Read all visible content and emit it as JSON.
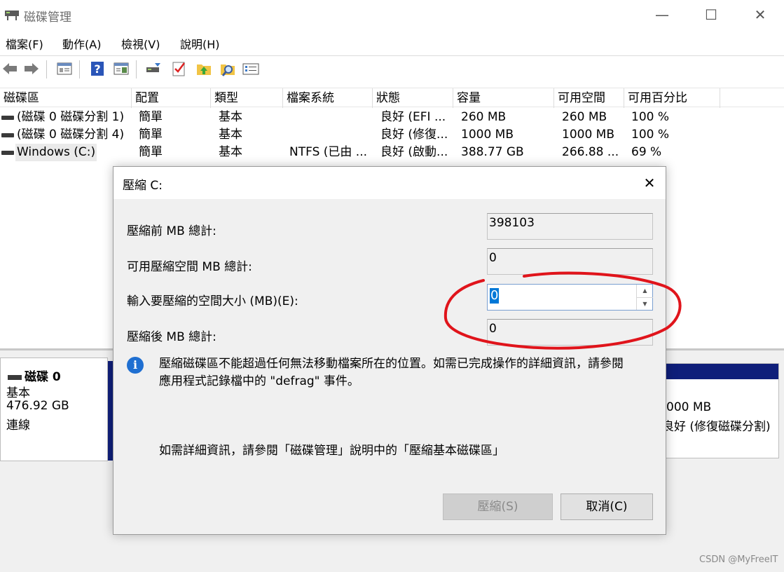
{
  "window": {
    "title": "磁碟管理",
    "controls": {
      "minimize": "—",
      "maximize": "☐",
      "close": "✕"
    }
  },
  "menu": [
    "檔案(F)",
    "動作(A)",
    "檢視(V)",
    "說明(H)"
  ],
  "toolbar": {
    "icons": [
      "back-arrow-icon",
      "forward-arrow-icon",
      "disk-list-icon",
      "help-icon",
      "panel-view-icon",
      "connect-icon",
      "checklist-icon",
      "up-arrow-icon",
      "search-icon",
      "properties-icon"
    ]
  },
  "volume_list": {
    "columns": [
      "磁碟區",
      "配置",
      "類型",
      "檔案系統",
      "狀態",
      "容量",
      "可用空間",
      "可用百分比"
    ],
    "rows": [
      [
        "(磁碟 0 磁碟分割 1)",
        "簡單",
        "基本",
        "",
        "良好 (EFI ...",
        "260 MB",
        "260 MB",
        "100 %"
      ],
      [
        "(磁碟 0 磁碟分割 4)",
        "簡單",
        "基本",
        "",
        "良好 (修復...",
        "1000 MB",
        "1000 MB",
        "100 %"
      ],
      [
        "Windows (C:)",
        "簡單",
        "基本",
        "NTFS (已由 ...",
        "良好 (啟動...",
        "388.77 GB",
        "266.88 ...",
        "69 %"
      ]
    ]
  },
  "disk_panel": {
    "name": "磁碟 0",
    "type": "基本",
    "size": "476.92 GB",
    "status": "連線"
  },
  "partition_panel": {
    "size": "000 MB",
    "status": "良好 (修復磁碟分割)"
  },
  "dialog": {
    "title": "壓縮 C:",
    "close": "✕",
    "fields": {
      "total_before_label": "壓縮前 MB 總計:",
      "total_before_value": "398103",
      "available_label": "可用壓縮空間 MB 總計:",
      "available_value": "0",
      "input_label": "輸入要壓縮的空間大小 (MB)(E):",
      "input_value": "0",
      "total_after_label": "壓縮後 MB 總計:",
      "total_after_value": "0"
    },
    "info_text_line1": "壓縮磁碟區不能超過任何無法移動檔案所在的位置。如需已完成操作的詳細資訊，請參閱",
    "info_text_line2": "應用程式記錄檔中的 \"defrag\" 事件。",
    "help_text": "如需詳細資訊，請參閱「磁碟管理」說明中的「壓縮基本磁碟區」",
    "buttons": {
      "shrink": "壓縮(S)",
      "cancel": "取消(C)"
    }
  },
  "watermark": "CSDN @MyFreeIT",
  "colors": {
    "accent": "#0078d7",
    "annotation": "#e0141b",
    "partition_header": "#0f1f7a"
  }
}
